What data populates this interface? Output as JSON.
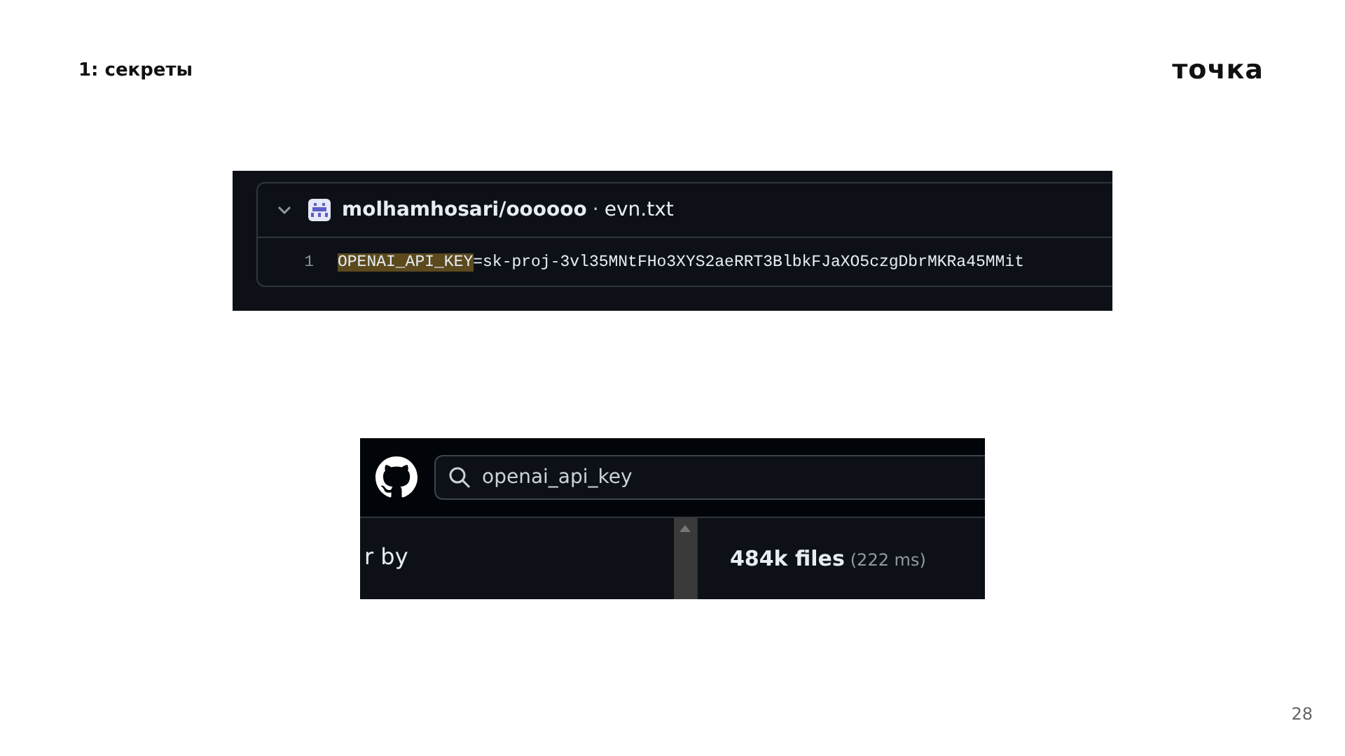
{
  "slide": {
    "title": "1: секреты",
    "logo": "точка",
    "page_number": "28"
  },
  "code_result": {
    "expanded": true,
    "repository": "molhamhosari/oooooo",
    "separator": "·",
    "file": "evn.txt",
    "lines": [
      {
        "number": "1",
        "highlight": "OPENAI_API_KEY",
        "rest": "=sk-proj-3vl35MNtFHo3XYS2aeRRT3BlbkFJaXO5czgDbrMKRa45MMit"
      }
    ]
  },
  "search_result": {
    "query": "openai_api_key",
    "sidebar_text": "r by",
    "result_count": "484k files",
    "timing": "(222 ms)"
  }
}
